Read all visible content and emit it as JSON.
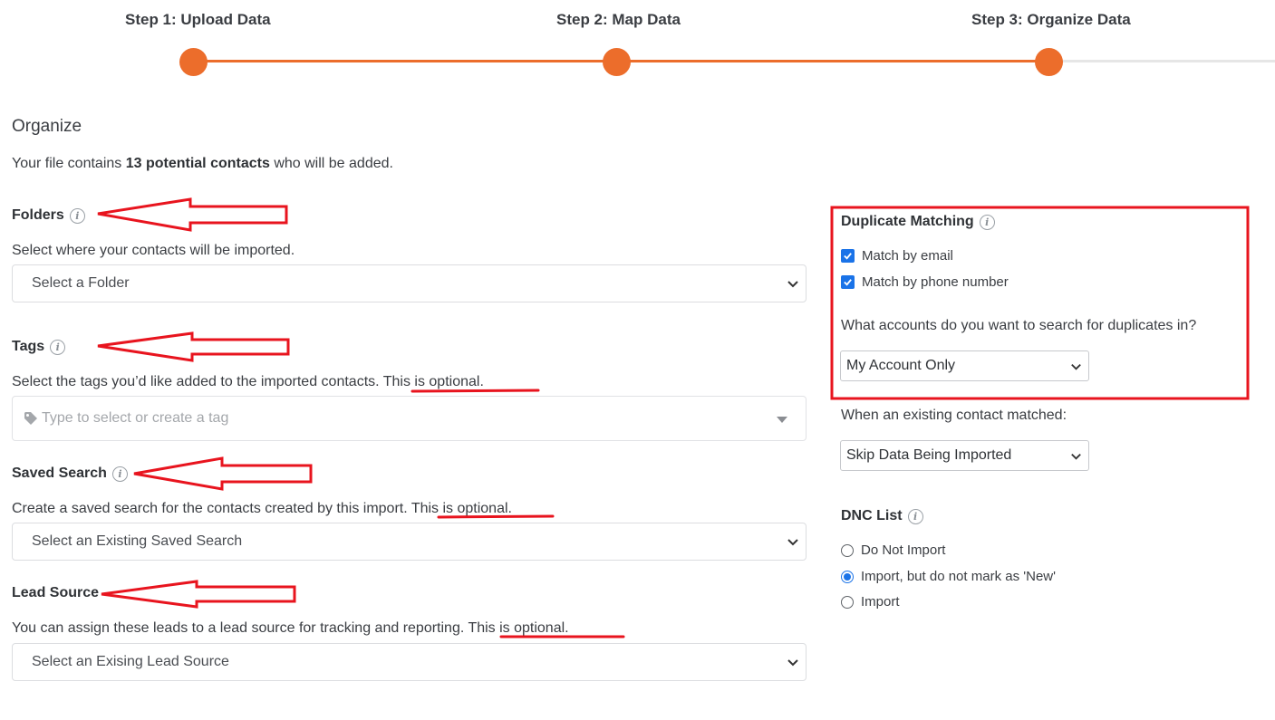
{
  "stepper": {
    "steps": [
      {
        "label": "Step 1: Upload Data"
      },
      {
        "label": "Step 2: Map Data"
      },
      {
        "label": "Step 3: Organize Data"
      }
    ]
  },
  "organize": {
    "title": "Organize",
    "intro_prefix": "Your file contains ",
    "intro_count": "13 potential contacts",
    "intro_suffix": " who will be added."
  },
  "folders": {
    "title": "Folders",
    "description": "Select where your contacts will be imported.",
    "select_value": "Select a Folder"
  },
  "tags": {
    "title": "Tags",
    "description": "Select the tags you’d like added to the imported contacts.",
    "optional": " This is optional.",
    "placeholder": "Type to select or create a tag"
  },
  "saved_search": {
    "title": "Saved Search",
    "description": "Create a saved search for the contacts created by this import.",
    "optional": " This is optional.",
    "select_value": "Select an Existing Saved Search"
  },
  "lead_source": {
    "title": "Lead Source",
    "description": "You can assign these leads to a lead source for tracking and reporting.",
    "optional": " This is optional.",
    "select_value": "Select an Exising Lead Source"
  },
  "duplicate_matching": {
    "title": "Duplicate Matching",
    "options": [
      {
        "label": "Match by email",
        "checked": true
      },
      {
        "label": "Match by phone number",
        "checked": true
      }
    ],
    "question": "What accounts do you want to search for duplicates in?",
    "accounts_value": "My Account Only",
    "existing_label": "When an existing contact matched:",
    "existing_value": "Skip Data Being Imported"
  },
  "dnc_list": {
    "title": "DNC List",
    "options": [
      {
        "label": "Do Not Import",
        "selected": false
      },
      {
        "label": "Import, but do not mark as 'New'",
        "selected": true
      },
      {
        "label": "Import",
        "selected": false
      }
    ]
  },
  "colors": {
    "accent": "#ec6d2b",
    "annotation": "#e8141e",
    "checkbox": "#1a73e8"
  }
}
